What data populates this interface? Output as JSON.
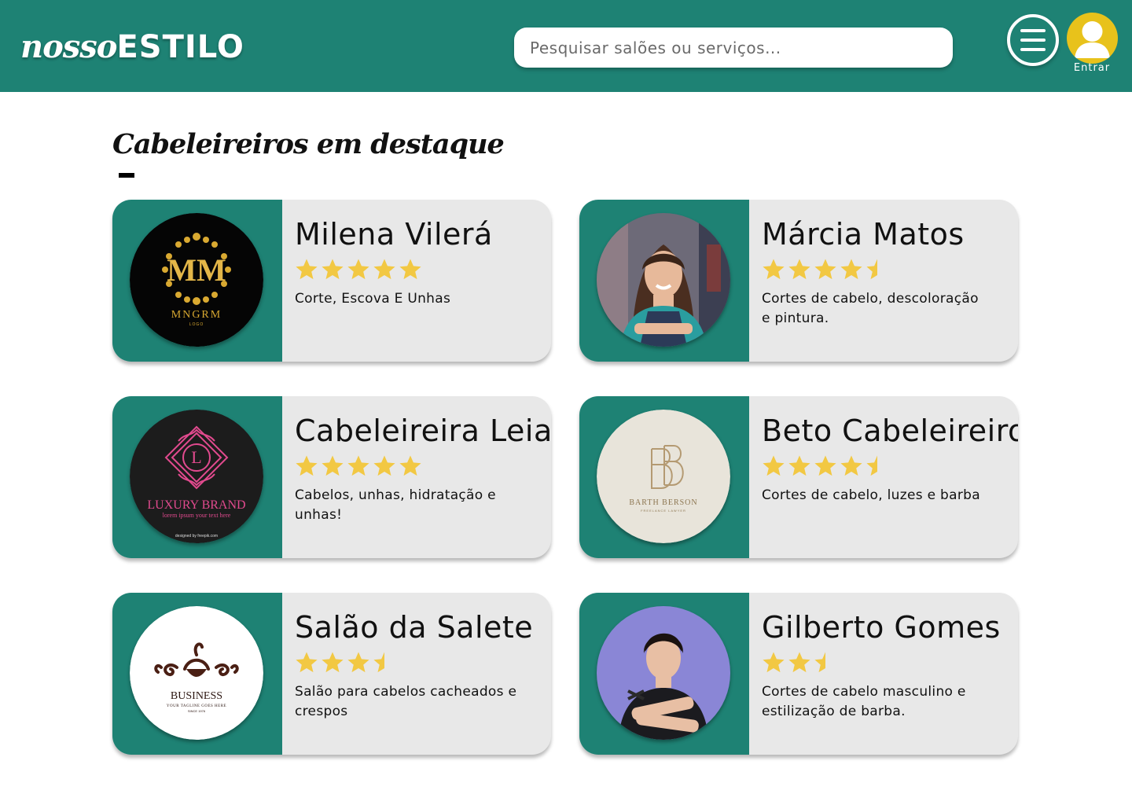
{
  "header": {
    "logo_italic": "nosso",
    "logo_bold": "ESTILO",
    "search_placeholder": "Pesquisar salões ou serviços...",
    "login_label": "Entrar"
  },
  "section": {
    "title": "Cabeleireiros em destaque"
  },
  "colors": {
    "brand": "#1e8274",
    "card_bg": "#e8e8e8",
    "star": "#f2c843",
    "user_button": "#e8c21b"
  },
  "cards": [
    {
      "name": "Milena Vilerá",
      "rating": 5,
      "description": "Corte, Escova E Unhas",
      "logo": {
        "kind": "mm",
        "monogram": "MM",
        "brand": "MNGRM",
        "sub": "LOGO"
      }
    },
    {
      "name": "Márcia Matos",
      "rating": 4.5,
      "description": "Cortes de cabelo, descoloração e pintura.",
      "logo": {
        "kind": "photo-woman"
      }
    },
    {
      "name": "Cabeleireira Leia",
      "rating": 5,
      "description": "Cabelos, unhas, hidratação e unhas!",
      "logo": {
        "kind": "luxury",
        "monogram": "L",
        "brand": "LUXURY BRAND",
        "tagline": "lorem ipsum your text here",
        "credit": "designed by freepik.com"
      }
    },
    {
      "name": "Beto Cabeleireiro",
      "rating": 4.5,
      "description": "Cortes de cabelo, luzes e barba",
      "logo": {
        "kind": "bb",
        "brand": "BARTH BERSON",
        "sub": "FREELANCE LAWYER"
      }
    },
    {
      "name": "Salão da Salete",
      "rating": 3.5,
      "description": "Salão para cabelos cacheados e crespos",
      "logo": {
        "kind": "business",
        "brand": "BUSINESS",
        "tagline": "YOUR TAGLINE GOES HERE",
        "since": "SINCE 1976"
      }
    },
    {
      "name": "Gilberto Gomes",
      "rating": 2.5,
      "description": "Cortes de cabelo masculino e estilização de barba.",
      "logo": {
        "kind": "photo-man"
      }
    }
  ]
}
